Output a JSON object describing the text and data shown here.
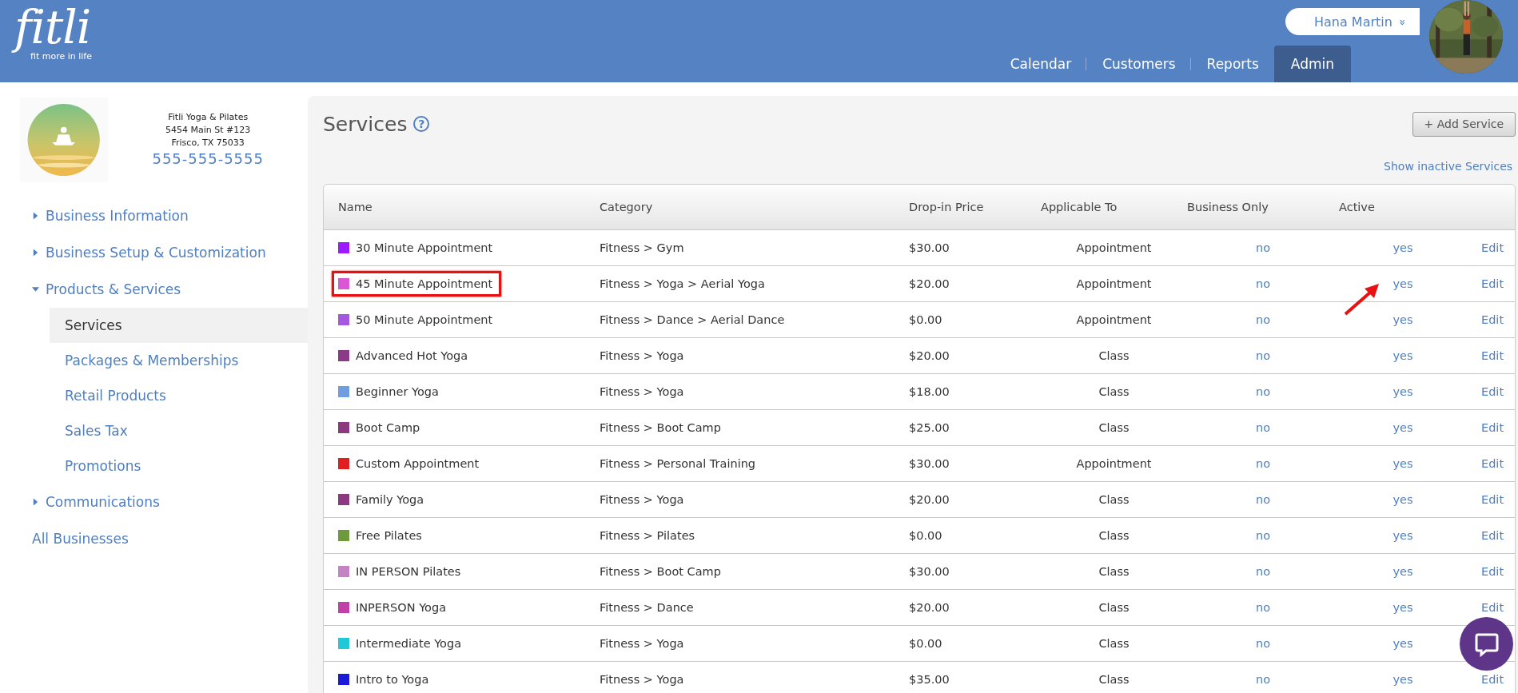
{
  "brand": {
    "logo": "fitli",
    "tagline": "fit more in life"
  },
  "user_menu": {
    "name": "Hana Martin",
    "caret": "»"
  },
  "tabs": [
    {
      "label": "Calendar",
      "selected": false
    },
    {
      "label": "Customers",
      "selected": false
    },
    {
      "label": "Reports",
      "selected": false
    },
    {
      "label": "Admin",
      "selected": true
    }
  ],
  "business": {
    "name": "Fitli Yoga & Pilates",
    "address": "5454 Main St #123",
    "city": "Frisco, TX 75033",
    "phone": "555-555-5555"
  },
  "sidebar": {
    "items": [
      {
        "kind": "group",
        "label": "Business Information",
        "expanded": false
      },
      {
        "kind": "group",
        "label": "Business Setup & Customization",
        "expanded": false
      },
      {
        "kind": "group",
        "label": "Products & Services",
        "expanded": true,
        "children": [
          {
            "label": "Services",
            "selected": true
          },
          {
            "label": "Packages & Memberships",
            "selected": false
          },
          {
            "label": "Retail Products",
            "selected": false
          },
          {
            "label": "Sales Tax",
            "selected": false
          },
          {
            "label": "Promotions",
            "selected": false
          }
        ]
      },
      {
        "kind": "group",
        "label": "Communications",
        "expanded": false
      },
      {
        "kind": "link",
        "label": "All Businesses"
      }
    ]
  },
  "page": {
    "title": "Services",
    "help": "?",
    "add_button": "+ Add Service",
    "inactive_link": "Show inactive Services"
  },
  "table": {
    "columns": [
      "Name",
      "Category",
      "Drop-in Price",
      "Applicable To",
      "Business Only",
      "Active"
    ],
    "rows": [
      {
        "name": "30 Minute Appointment",
        "color": "#9b1aff",
        "category": "Fitness > Gym",
        "price": "$30.00",
        "applicable": "Appointment",
        "business_only": "no",
        "active": "yes",
        "edit": "Edit",
        "highlighted": false,
        "arrow": false
      },
      {
        "name": "45 Minute Appointment",
        "color": "#d957d4",
        "category": "Fitness > Yoga > Aerial Yoga",
        "price": "$20.00",
        "applicable": "Appointment",
        "business_only": "no",
        "active": "yes",
        "edit": "Edit",
        "highlighted": true,
        "arrow": true
      },
      {
        "name": "50 Minute Appointment",
        "color": "#a458dd",
        "category": "Fitness > Dance > Aerial Dance",
        "price": "$0.00",
        "applicable": "Appointment",
        "business_only": "no",
        "active": "yes",
        "edit": "Edit",
        "highlighted": false,
        "arrow": false
      },
      {
        "name": "Advanced Hot Yoga",
        "color": "#8b3a87",
        "category": "Fitness > Yoga",
        "price": "$20.00",
        "applicable": "Class",
        "business_only": "no",
        "active": "yes",
        "edit": "Edit",
        "highlighted": false,
        "arrow": false
      },
      {
        "name": "Beginner Yoga",
        "color": "#6f9de0",
        "category": "Fitness > Yoga",
        "price": "$18.00",
        "applicable": "Class",
        "business_only": "no",
        "active": "yes",
        "edit": "Edit",
        "highlighted": false,
        "arrow": false
      },
      {
        "name": "Boot Camp",
        "color": "#8b3a80",
        "category": "Fitness > Boot Camp",
        "price": "$25.00",
        "applicable": "Class",
        "business_only": "no",
        "active": "yes",
        "edit": "Edit",
        "highlighted": false,
        "arrow": false
      },
      {
        "name": "Custom Appointment",
        "color": "#e02020",
        "category": "Fitness > Personal Training",
        "price": "$30.00",
        "applicable": "Appointment",
        "business_only": "no",
        "active": "yes",
        "edit": "Edit",
        "highlighted": false,
        "arrow": false
      },
      {
        "name": "Family Yoga",
        "color": "#8b3a7f",
        "category": "Fitness > Yoga",
        "price": "$20.00",
        "applicable": "Class",
        "business_only": "no",
        "active": "yes",
        "edit": "Edit",
        "highlighted": false,
        "arrow": false
      },
      {
        "name": "Free Pilates",
        "color": "#6e9a3c",
        "category": "Fitness > Pilates",
        "price": "$0.00",
        "applicable": "Class",
        "business_only": "no",
        "active": "yes",
        "edit": "Edit",
        "highlighted": false,
        "arrow": false
      },
      {
        "name": "IN PERSON Pilates",
        "color": "#c484c4",
        "category": "Fitness > Boot Camp",
        "price": "$30.00",
        "applicable": "Class",
        "business_only": "no",
        "active": "yes",
        "edit": "Edit",
        "highlighted": false,
        "arrow": false
      },
      {
        "name": "INPERSON Yoga",
        "color": "#c040a8",
        "category": "Fitness > Dance",
        "price": "$20.00",
        "applicable": "Class",
        "business_only": "no",
        "active": "yes",
        "edit": "Edit",
        "highlighted": false,
        "arrow": false
      },
      {
        "name": "Intermediate Yoga",
        "color": "#20c8d8",
        "category": "Fitness > Yoga",
        "price": "$0.00",
        "applicable": "Class",
        "business_only": "no",
        "active": "yes",
        "highlighted": false,
        "arrow": false
      },
      {
        "name": "Intro to Yoga",
        "color": "#1a1ad8",
        "category": "Fitness > Yoga",
        "price": "$35.00",
        "applicable": "Class",
        "business_only": "no",
        "active": "yes",
        "edit": "Edit",
        "highlighted": false,
        "arrow": false
      }
    ]
  },
  "chat_button": {
    "visible": true
  }
}
